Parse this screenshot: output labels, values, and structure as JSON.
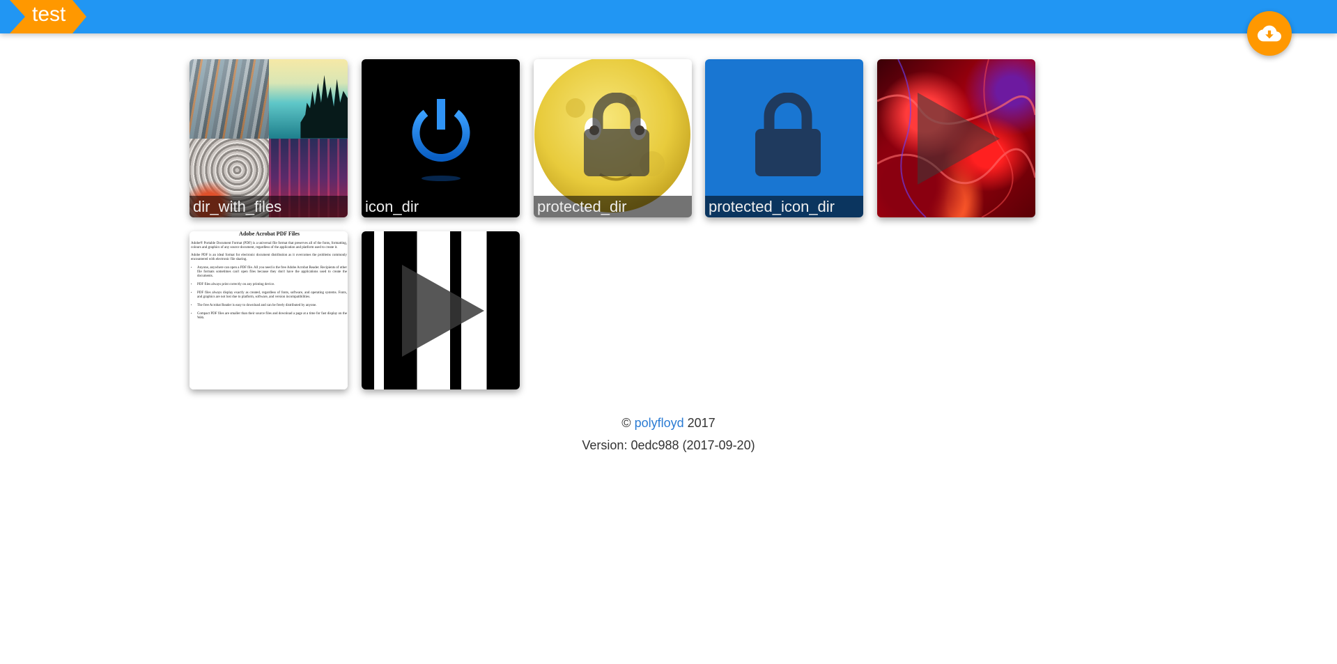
{
  "header": {
    "breadcrumb_label": "test",
    "colors": {
      "bar": "#2196f3",
      "accent": "#ff9800"
    },
    "upload_icon": "cloud-download-icon"
  },
  "gallery": {
    "items": [
      {
        "label": "dir_with_files",
        "kind": "directory",
        "thumb": "photo-collage"
      },
      {
        "label": "icon_dir",
        "kind": "directory",
        "thumb": "power-icon"
      },
      {
        "label": "protected_dir",
        "kind": "protected-directory",
        "thumb": "moon-face",
        "overlay_icon": "lock-icon"
      },
      {
        "label": "protected_icon_dir",
        "kind": "protected-directory",
        "thumb": "blue",
        "overlay_icon": "lock-icon"
      },
      {
        "kind": "video",
        "thumb": "red-plasma",
        "overlay_icon": "play-icon"
      },
      {
        "kind": "document",
        "thumb": "pdf-page"
      },
      {
        "kind": "video",
        "thumb": "black-white-bars",
        "overlay_icon": "play-icon"
      }
    ],
    "pdf_preview": {
      "title": "Adobe Acrobat PDF Files",
      "paragraphs": [
        "Adobe® Portable Document Format (PDF) is a universal file format that preserves all of the fonts, formatting, colours and graphics of any source document, regardless of the application and platform used to create it.",
        "Adobe PDF is an ideal format for electronic document distribution as it overcomes the problems commonly encountered with electronic file sharing."
      ],
      "bullets": [
        "Anyone, anywhere can open a PDF file. All you need is the free Adobe Acrobat Reader. Recipients of other file formats sometimes can't open files because they don't have the applications used to create the documents.",
        "PDF files always print correctly on any printing device.",
        "PDF files always display exactly as created, regardless of fonts, software, and operating systems. Fonts, and graphics are not lost due to platform, software, and version incompatibilities.",
        "The free Acrobat Reader is easy to download and can be freely distributed by anyone.",
        "Compact PDF files are smaller than their source files and download a page at a time for fast display on the Web."
      ]
    }
  },
  "footer": {
    "copyright_symbol": "©",
    "author_link": "polyfloyd",
    "year": "2017",
    "version": "Version: 0edc988 (2017-09-20)"
  }
}
